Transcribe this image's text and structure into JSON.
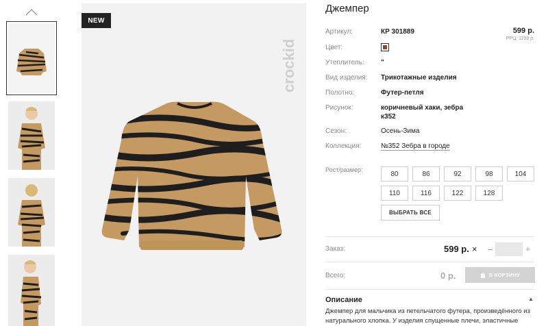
{
  "gallery": {
    "badge": "NEW",
    "brand": "crockid",
    "thumbnails": [
      {
        "alt": "sweater-front"
      },
      {
        "alt": "model-front"
      },
      {
        "alt": "model-back"
      },
      {
        "alt": "model-side"
      }
    ]
  },
  "product": {
    "title": "Джемпер",
    "price": "599 р.",
    "rrp": "РРЦ: 1199 р.",
    "swatch_color": "#8a4a2c",
    "attributes": {
      "article_label": "Артикул:",
      "article_value": "КР 301889",
      "color_label": "Цвет:",
      "insulation_label": "Утеплитель:",
      "insulation_value": "\"",
      "type_label": "Вид изделия:",
      "type_value": "Трикотажные изделия",
      "fabric_label": "Полотно:",
      "fabric_value": "Футер-петля",
      "pattern_label": "Рисунок:",
      "pattern_value_1": "коричневый хаки, зебра",
      "pattern_value_2": "к352",
      "season_label": "Сезон:",
      "season_value": "Осень-Зима",
      "collection_label": "Коллекция:",
      "collection_value": "№352 Зебра в городе"
    }
  },
  "sizes": {
    "label": "Рост/размер:",
    "options": [
      "80",
      "86",
      "92",
      "98",
      "104",
      "110",
      "116",
      "122",
      "128"
    ],
    "select_all": "ВЫБРАТЬ ВСЕ"
  },
  "order": {
    "label": "Заказ:",
    "price": "599 р.",
    "times": "×",
    "minus": "–",
    "plus": "+",
    "total_label": "Всего:",
    "total_value": "0 р.",
    "cart_button": "В КОРЗИНУ"
  },
  "description": {
    "title": "Описание",
    "caret": "▲",
    "text": "Джемпер для мальчика из петельчатого футера, произведённого из натурального хлопка. У изделия спущенные плечи, эластичные"
  },
  "colors": {
    "accent_dark": "#222222",
    "camel": "#c49a62",
    "stripe": "#1e1e1e",
    "button_disabled": "#d3d3d3"
  }
}
